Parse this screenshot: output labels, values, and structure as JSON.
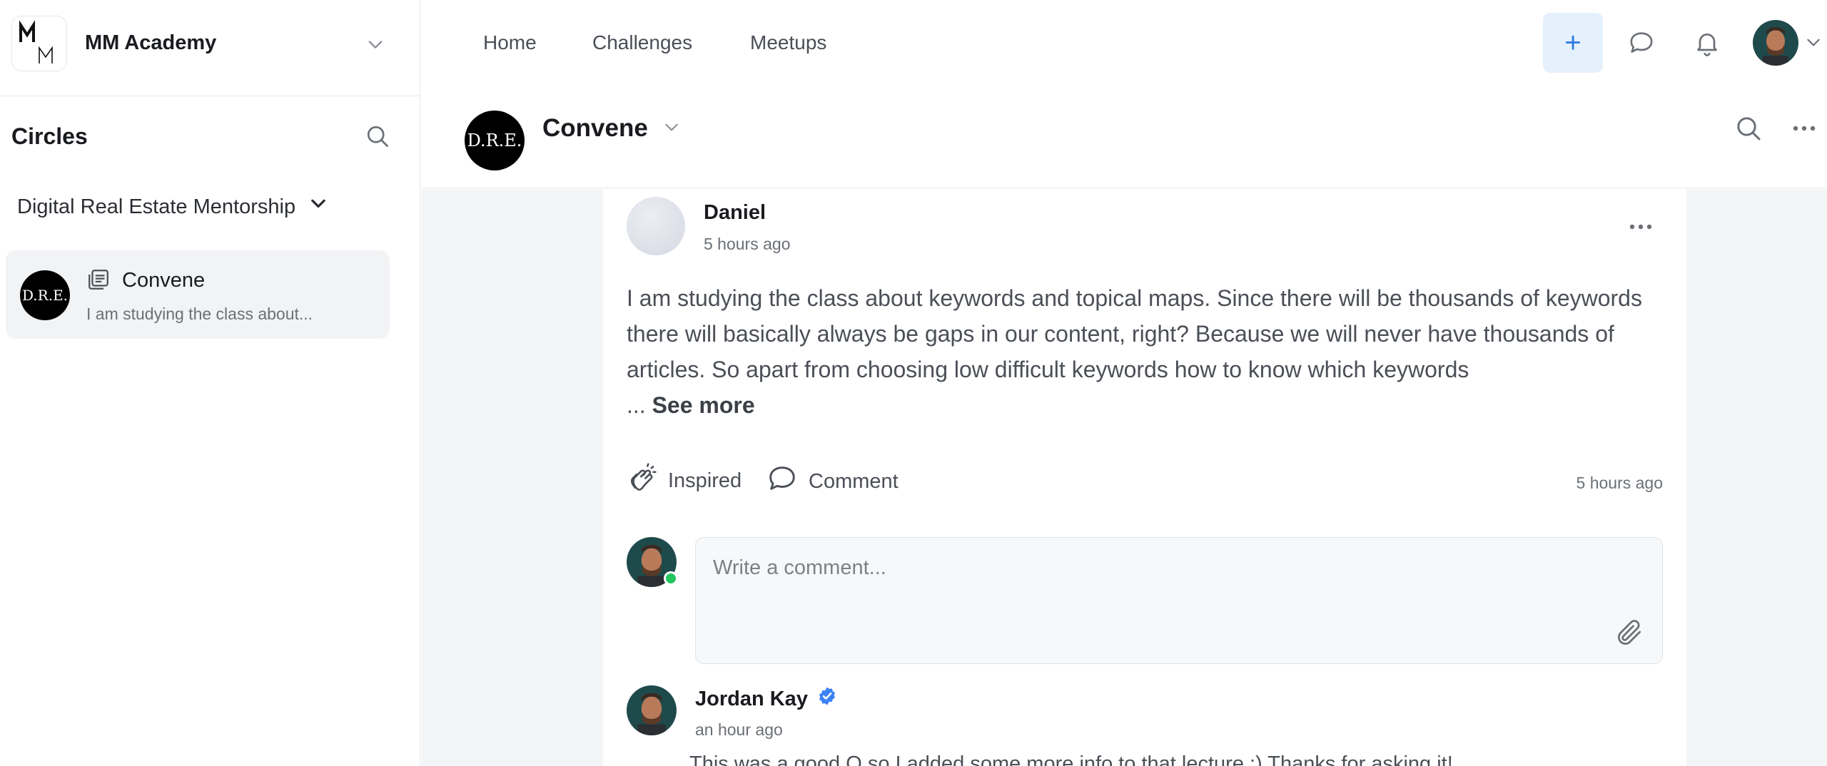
{
  "sidebar": {
    "brand_name": "MM Academy",
    "brand_logo_letters": "MM",
    "circles_title": "Circles",
    "space_group_label": "Digital Real Estate Mentorship",
    "space_item": {
      "avatar_text": "D.R.E.",
      "name": "Convene",
      "preview": "I am studying the class about..."
    }
  },
  "topnav": {
    "links": [
      "Home",
      "Challenges",
      "Meetups"
    ],
    "create_label": "+"
  },
  "header": {
    "avatar_text": "D.R.E.",
    "title": "Convene"
  },
  "post": {
    "author": "Daniel",
    "time": "5 hours ago",
    "body": "I am studying the class about keywords and topical maps. Since there will be thousands of keywords there will basically always be gaps in our content, right? Because we will never have thousands of articles. So apart from choosing low difficult keywords how to know which keywords",
    "ellipsis": "...",
    "see_more": "See more",
    "actions": {
      "inspired": "Inspired",
      "comment": "Comment",
      "time": "5 hours ago"
    },
    "comment_placeholder": "Write a comment...",
    "reply": {
      "author": "Jordan Kay",
      "time": "an hour ago",
      "body": "This was a good Q so I added some more info to that lecture :) Thanks for asking it!"
    }
  },
  "colors": {
    "accent": "#2f7be0",
    "accent_bg": "#e5f0fd",
    "online": "#22c55e",
    "verified": "#3b82f6"
  },
  "icons": [
    "chevron-down-icon",
    "search-icon",
    "posts-icon",
    "plus-icon",
    "chat-icon",
    "bell-icon",
    "more-icon",
    "clap-icon",
    "comment-icon",
    "paperclip-icon",
    "verified-icon"
  ]
}
